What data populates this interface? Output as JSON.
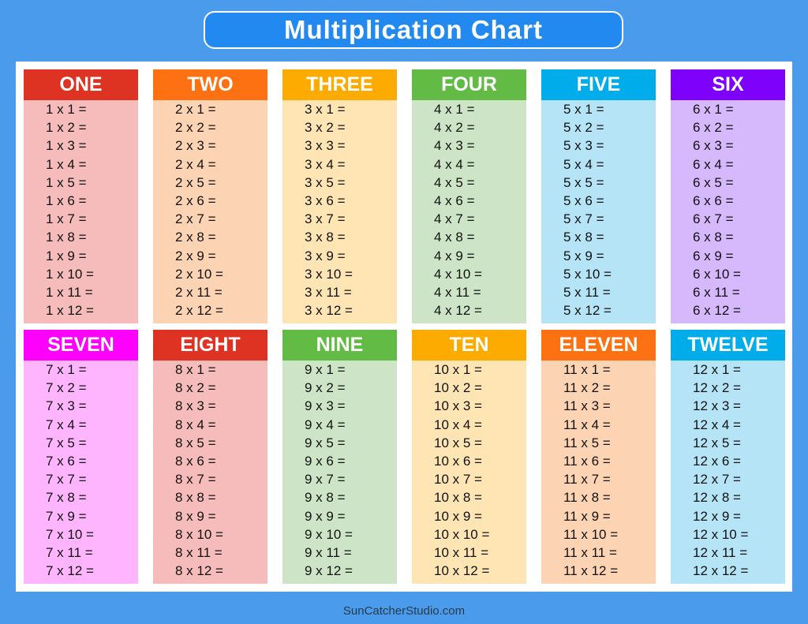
{
  "title": "Multiplication Chart",
  "footer": "SunCatcherStudio.com",
  "colors": {
    "background": "#4a9bec",
    "title_box": "#2289f0"
  },
  "tables": [
    {
      "label": "ONE",
      "n": 1,
      "head": "#de3223",
      "body": "#f6bcbc"
    },
    {
      "label": "TWO",
      "n": 2,
      "head": "#fe7112",
      "body": "#fdd4b3"
    },
    {
      "label": "THREE",
      "n": 3,
      "head": "#feab01",
      "body": "#ffe5b4"
    },
    {
      "label": "FOUR",
      "n": 4,
      "head": "#62bb45",
      "body": "#cde5c6"
    },
    {
      "label": "FIVE",
      "n": 5,
      "head": "#01aceb",
      "body": "#b4e4f6"
    },
    {
      "label": "SIX",
      "n": 6,
      "head": "#7e01fc",
      "body": "#d6b8fd"
    },
    {
      "label": "SEVEN",
      "n": 7,
      "head": "#fd01fd",
      "body": "#feb5fe"
    },
    {
      "label": "EIGHT",
      "n": 8,
      "head": "#de3223",
      "body": "#f6bcbc"
    },
    {
      "label": "NINE",
      "n": 9,
      "head": "#62bb45",
      "body": "#cde5c6"
    },
    {
      "label": "TEN",
      "n": 10,
      "head": "#feab01",
      "body": "#ffe5b4"
    },
    {
      "label": "ELEVEN",
      "n": 11,
      "head": "#fe7112",
      "body": "#fdd4b3"
    },
    {
      "label": "TWELVE",
      "n": 12,
      "head": "#01aceb",
      "body": "#b4e4f6"
    }
  ],
  "rows": [
    [
      "1 x 1 =",
      "1 x 2 =",
      "1 x 3 =",
      "1 x 4 =",
      "1 x 5 =",
      "1 x 6 =",
      "1 x 7 =",
      "1 x 8 =",
      "1 x 9 =",
      "1 x 10 =",
      "1 x 11 =",
      "1 x 12 ="
    ],
    [
      "2 x 1 =",
      "2 x 2 =",
      "2 x 3 =",
      "2 x 4 =",
      "2 x 5 =",
      "2 x 6 =",
      "2 x 7 =",
      "2 x 8 =",
      "2 x 9 =",
      "2 x 10 =",
      "2 x 11 =",
      "2 x 12 ="
    ],
    [
      "3 x 1 =",
      "3 x 2 =",
      "3 x 3 =",
      "3 x 4 =",
      "3 x 5 =",
      "3 x 6 =",
      "3 x 7 =",
      "3 x 8 =",
      "3 x 9 =",
      "3 x 10 =",
      "3 x 11 =",
      "3 x 12 ="
    ],
    [
      "4 x 1 =",
      "4 x 2 =",
      "4 x 3 =",
      "4 x 4 =",
      "4 x 5 =",
      "4 x 6 =",
      "4 x 7 =",
      "4 x 8 =",
      "4 x 9 =",
      "4 x 10 =",
      "4 x 11 =",
      "4 x 12 ="
    ],
    [
      "5 x 1 =",
      "5 x 2 =",
      "5 x 3 =",
      "5 x 4 =",
      "5 x 5 =",
      "5 x 6 =",
      "5 x 7 =",
      "5 x 8 =",
      "5 x 9 =",
      "5 x 10 =",
      "5 x 11 =",
      "5 x 12 ="
    ],
    [
      "6 x 1 =",
      "6 x 2 =",
      "6 x 3 =",
      "6 x 4 =",
      "6 x 5 =",
      "6 x 6 =",
      "6 x 7 =",
      "6 x 8 =",
      "6 x 9 =",
      "6 x 10 =",
      "6 x 11 =",
      "6 x 12 ="
    ],
    [
      "7 x 1 =",
      "7 x 2 =",
      "7 x 3 =",
      "7 x 4 =",
      "7 x 5 =",
      "7 x 6 =",
      "7 x 7 =",
      "7 x 8 =",
      "7 x 9 =",
      "7 x 10 =",
      "7 x 11 =",
      "7 x 12 ="
    ],
    [
      "8 x 1 =",
      "8 x 2 =",
      "8 x 3 =",
      "8 x 4 =",
      "8 x 5 =",
      "8 x 6 =",
      "8 x 7 =",
      "8 x 8 =",
      "8 x 9 =",
      "8 x 10 =",
      "8 x 11 =",
      "8 x 12 ="
    ],
    [
      "9 x 1 =",
      "9 x 2 =",
      "9 x 3 =",
      "9 x 4 =",
      "9 x 5 =",
      "9 x 6 =",
      "9 x 7 =",
      "9 x 8 =",
      "9 x 9 =",
      "9 x 10 =",
      "9 x 11 =",
      "9 x 12 ="
    ],
    [
      "10 x 1 =",
      "10 x 2 =",
      "10 x 3 =",
      "10 x 4 =",
      "10 x 5 =",
      "10 x 6 =",
      "10 x 7 =",
      "10 x 8 =",
      "10 x 9 =",
      "10 x 10 =",
      "10 x 11 =",
      "10 x 12 ="
    ],
    [
      "11 x 1 =",
      "11 x 2 =",
      "11 x 3 =",
      "11 x 4 =",
      "11 x 5 =",
      "11 x 6 =",
      "11 x 7 =",
      "11 x 8 =",
      "11 x 9 =",
      "11 x 10 =",
      "11 x 11 =",
      "11 x 12 ="
    ],
    [
      "12 x 1 =",
      "12 x 2 =",
      "12 x 3 =",
      "12 x 4 =",
      "12 x 5 =",
      "12 x 6 =",
      "12 x 7 =",
      "12 x 8 =",
      "12 x 9 =",
      "12 x 10 =",
      "12 x 11 =",
      "12 x 12 ="
    ]
  ]
}
